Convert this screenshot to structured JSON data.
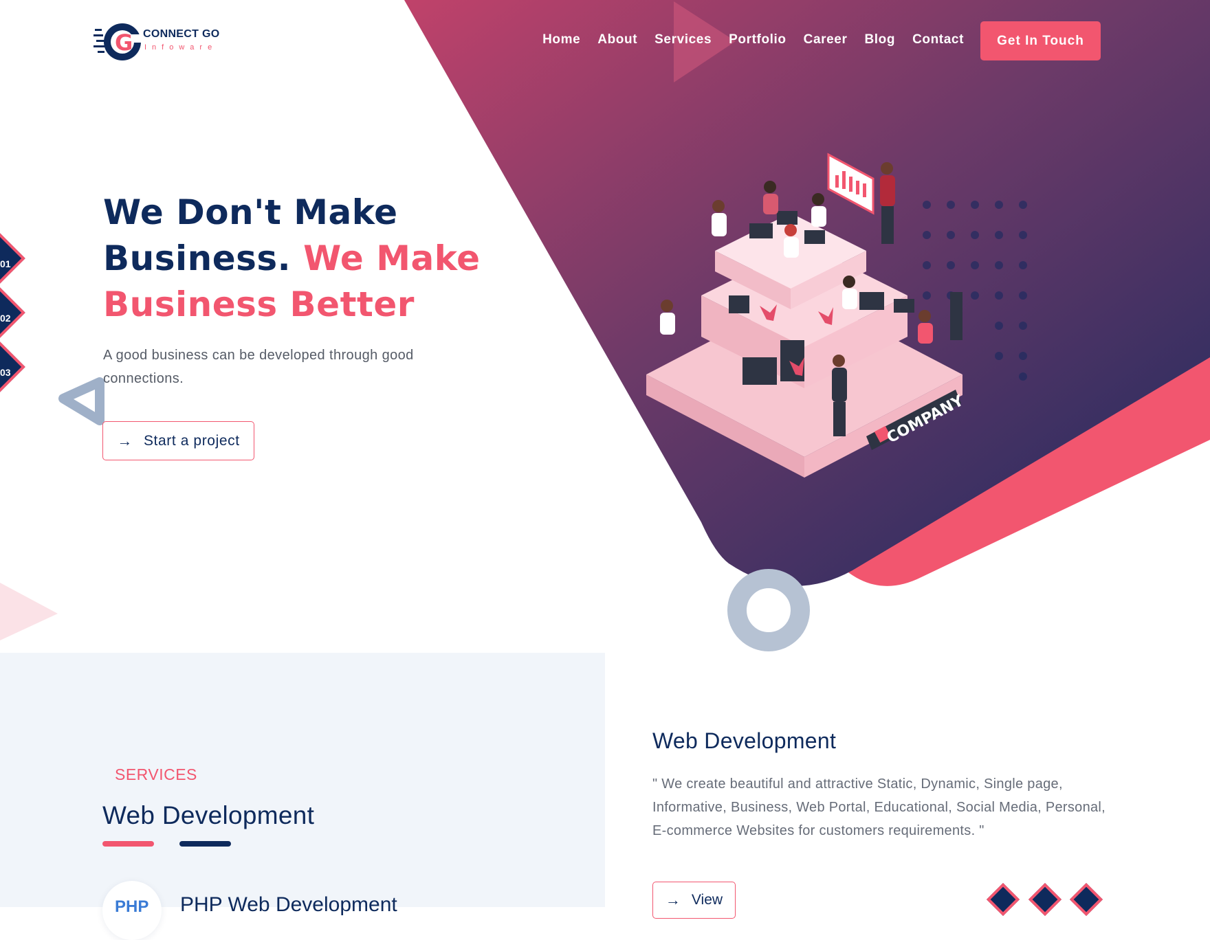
{
  "brand": {
    "name": "CONNECT GO",
    "tagline": "Infoware",
    "colors": {
      "navy": "#0e2a5c",
      "pink": "#f2566f",
      "purple": "#7a3a6a",
      "panel": "#f1f5fa"
    }
  },
  "nav": {
    "items": [
      "Home",
      "About",
      "Services",
      "Portfolio",
      "Career",
      "Blog",
      "Contact"
    ],
    "cta": "Get In Touch"
  },
  "hero": {
    "title_line1": "We Don't Make",
    "title_line2_a": "Business.",
    "title_line2_b": "We Make",
    "title_line3": "Business Better",
    "description": "A good business can be developed through good connections.",
    "button_label": "Start a project",
    "slides": [
      "01",
      "02",
      "03"
    ],
    "illustration_label": "COMPANY"
  },
  "services": {
    "label": "SERVICES",
    "heading": "Web Development",
    "item_title": "PHP Web Development",
    "item_icon_text": "PHP"
  },
  "detail": {
    "title": "Web Development",
    "text": "\" We create beautiful and attractive Static, Dynamic, Single page, Informative, Business, Web Portal, Educational, Social Media, Personal, E-commerce Websites for customers requirements. \"",
    "button_label": "View"
  },
  "icons": {
    "arrow": "arrow-right-icon",
    "logo": "connect-go-logo-icon"
  }
}
